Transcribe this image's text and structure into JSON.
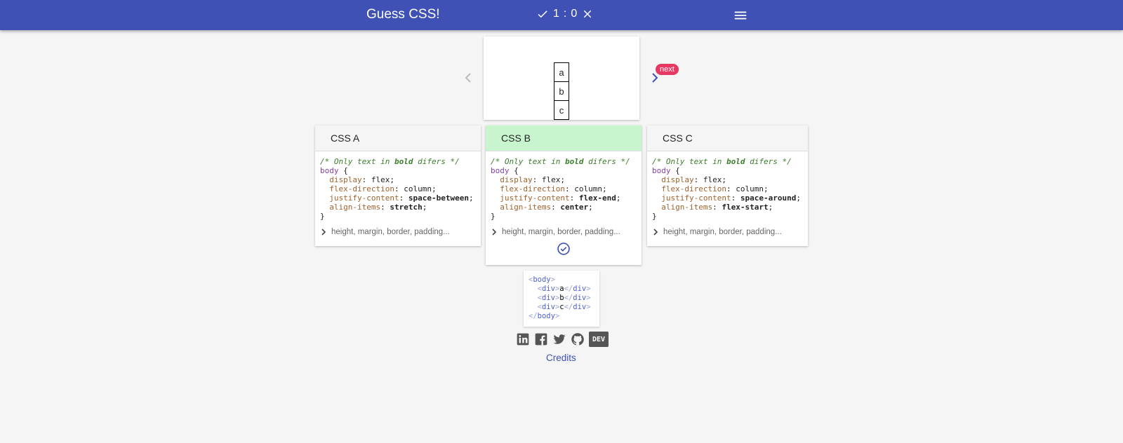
{
  "header": {
    "title": "Guess CSS!",
    "score": {
      "correct": "1",
      "separator": ":",
      "wrong": "0"
    }
  },
  "preview": {
    "items": [
      "a",
      "b",
      "c"
    ],
    "next_badge": "next"
  },
  "cards": [
    {
      "title": "CSS A",
      "comment_pre": "/* Only text in ",
      "comment_bold": "bold",
      "comment_post": " difers */",
      "selector": "body",
      "open_brace": "{",
      "close_brace": "}",
      "decls": [
        {
          "prop": "display",
          "value": "flex",
          "bold": false
        },
        {
          "prop": "flex-direction",
          "value": "column",
          "bold": false
        },
        {
          "prop": "justify-content",
          "value": "space-between",
          "bold": true
        },
        {
          "prop": "align-items",
          "value": "stretch",
          "bold": true
        }
      ],
      "more": "height, margin, border, padding..."
    },
    {
      "title": "CSS B",
      "comment_pre": "/* Only text in ",
      "comment_bold": "bold",
      "comment_post": " difers */",
      "selector": "body",
      "open_brace": "{",
      "close_brace": "}",
      "decls": [
        {
          "prop": "display",
          "value": "flex",
          "bold": false
        },
        {
          "prop": "flex-direction",
          "value": "column",
          "bold": false
        },
        {
          "prop": "justify-content",
          "value": "flex-end",
          "bold": true
        },
        {
          "prop": "align-items",
          "value": "center",
          "bold": true
        }
      ],
      "more": "height, margin, border, padding...",
      "correct": true
    },
    {
      "title": "CSS C",
      "comment_pre": "/* Only text in ",
      "comment_bold": "bold",
      "comment_post": " difers */",
      "selector": "body",
      "open_brace": "{",
      "close_brace": "}",
      "decls": [
        {
          "prop": "display",
          "value": "flex",
          "bold": false
        },
        {
          "prop": "flex-direction",
          "value": "column",
          "bold": false
        },
        {
          "prop": "justify-content",
          "value": "space-around",
          "bold": true
        },
        {
          "prop": "align-items",
          "value": "flex-start",
          "bold": true
        }
      ],
      "more": "height, margin, border, padding..."
    }
  ],
  "html_snippet": {
    "body_tag": "body",
    "div_tag": "div",
    "items": [
      "a",
      "b",
      "c"
    ]
  },
  "footer": {
    "icons": [
      "linkedin-icon",
      "facebook-icon",
      "twitter-icon",
      "github-icon",
      "dev-icon"
    ],
    "dev_label": "DEV",
    "credits": "Credits"
  },
  "colors": {
    "primary": "#3f51b5",
    "correct_bg": "#c8f5cd",
    "badge": "#e53963"
  }
}
